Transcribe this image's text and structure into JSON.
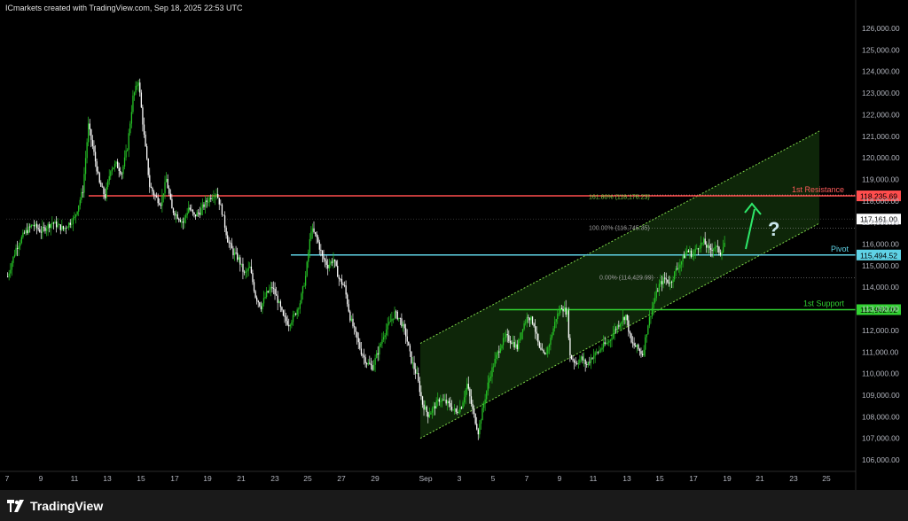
{
  "header": {
    "text": "ICmarkets created with TradingView.com, Sep 18, 2025 22:53 UTC"
  },
  "brand": {
    "name": "TradingView",
    "logo_icon": "tradingview-logo-icon"
  },
  "colors": {
    "background": "#000000",
    "candle_up": "#26c226",
    "candle_down": "#ffffff",
    "resistance": "#ff4d4d",
    "pivot": "#5fd3e6",
    "support": "#32d232",
    "channel": "#7fd84a",
    "channel_fill": "#0f2a0a",
    "arrow": "#2ee86a",
    "question": "#c9e6ec"
  },
  "chart_data": {
    "type": "candlestick",
    "title": "",
    "xlabel": "",
    "ylabel": "",
    "ylim": [
      105500,
      126500
    ],
    "x_tick_labels": [
      "7",
      "9",
      "11",
      "13",
      "15",
      "17",
      "19",
      "21",
      "23",
      "25",
      "27",
      "29",
      "Sep",
      "3",
      "5",
      "7",
      "9",
      "11",
      "13",
      "15",
      "17",
      "19",
      "21",
      "23",
      "25"
    ],
    "y_tick_labels": [
      "106,000.00",
      "107,000.00",
      "108,000.00",
      "109,000.00",
      "110,000.00",
      "111,000.00",
      "112,000.00",
      "113,000.00",
      "114,000.00",
      "115,000.00",
      "116,000.00",
      "117,000.00",
      "118,000.00",
      "119,000.00",
      "120,000.00",
      "121,000.00",
      "122,000.00",
      "123,000.00",
      "124,000.00",
      "125,000.00",
      "126,000.00"
    ],
    "y_ticks": [
      106000,
      107000,
      108000,
      109000,
      110000,
      111000,
      112000,
      113000,
      114000,
      115000,
      116000,
      117000,
      118000,
      119000,
      120000,
      121000,
      122000,
      123000,
      124000,
      125000,
      126000
    ],
    "price_path": [
      [
        0,
        114500
      ],
      [
        3,
        115800
      ],
      [
        6,
        116500
      ],
      [
        9,
        116900
      ],
      [
        12,
        116600
      ],
      [
        16,
        117000
      ],
      [
        20,
        116700
      ],
      [
        24,
        117200
      ],
      [
        27,
        118500
      ],
      [
        29,
        121500
      ],
      [
        31,
        120200
      ],
      [
        33,
        118800
      ],
      [
        35,
        118200
      ],
      [
        37,
        119500
      ],
      [
        39,
        119700
      ],
      [
        41,
        119300
      ],
      [
        43,
        120500
      ],
      [
        45,
        122800
      ],
      [
        47,
        123600
      ],
      [
        49,
        121000
      ],
      [
        51,
        118700
      ],
      [
        53,
        118200
      ],
      [
        55,
        117900
      ],
      [
        57,
        119000
      ],
      [
        59,
        117600
      ],
      [
        61,
        117300
      ],
      [
        63,
        117000
      ],
      [
        65,
        117700
      ],
      [
        67,
        117300
      ],
      [
        69,
        117500
      ],
      [
        71,
        117900
      ],
      [
        73,
        118200
      ],
      [
        75,
        118400
      ],
      [
        77,
        117500
      ],
      [
        79,
        116200
      ],
      [
        81,
        115600
      ],
      [
        83,
        115300
      ],
      [
        85,
        114600
      ],
      [
        87,
        114900
      ],
      [
        89,
        113600
      ],
      [
        91,
        113100
      ],
      [
        93,
        113700
      ],
      [
        95,
        114000
      ],
      [
        97,
        113400
      ],
      [
        99,
        112600
      ],
      [
        101,
        112300
      ],
      [
        103,
        112700
      ],
      [
        105,
        113300
      ],
      [
        107,
        114500
      ],
      [
        109,
        116700
      ],
      [
        111,
        116300
      ],
      [
        113,
        115400
      ],
      [
        115,
        115000
      ],
      [
        117,
        115300
      ],
      [
        119,
        114400
      ],
      [
        121,
        114000
      ],
      [
        123,
        112600
      ],
      [
        125,
        111800
      ],
      [
        127,
        111000
      ],
      [
        129,
        110500
      ],
      [
        131,
        110300
      ],
      [
        133,
        111000
      ],
      [
        135,
        111800
      ],
      [
        137,
        112300
      ],
      [
        139,
        112800
      ],
      [
        141,
        112500
      ],
      [
        143,
        111800
      ],
      [
        145,
        110600
      ],
      [
        147,
        109900
      ],
      [
        149,
        108600
      ],
      [
        151,
        108100
      ],
      [
        153,
        108400
      ],
      [
        155,
        108800
      ],
      [
        157,
        108700
      ],
      [
        159,
        108500
      ],
      [
        161,
        108200
      ],
      [
        163,
        108500
      ],
      [
        165,
        109500
      ],
      [
        167,
        108300
      ],
      [
        169,
        107300
      ],
      [
        171,
        108600
      ],
      [
        173,
        109800
      ],
      [
        175,
        110600
      ],
      [
        177,
        111300
      ],
      [
        179,
        111700
      ],
      [
        181,
        111500
      ],
      [
        183,
        111200
      ],
      [
        185,
        112200
      ],
      [
        187,
        112700
      ],
      [
        189,
        112300
      ],
      [
        191,
        111100
      ],
      [
        193,
        110800
      ],
      [
        195,
        111600
      ],
      [
        197,
        112600
      ],
      [
        199,
        113100
      ],
      [
        201,
        112800
      ],
      [
        202,
        110800
      ],
      [
        204,
        110500
      ],
      [
        206,
        110700
      ],
      [
        208,
        110400
      ],
      [
        210,
        110800
      ],
      [
        212,
        111000
      ],
      [
        214,
        111300
      ],
      [
        216,
        111500
      ],
      [
        218,
        112000
      ],
      [
        220,
        112400
      ],
      [
        222,
        112700
      ],
      [
        224,
        111400
      ],
      [
        226,
        111200
      ],
      [
        228,
        110900
      ],
      [
        230,
        112300
      ],
      [
        232,
        113300
      ],
      [
        234,
        114100
      ],
      [
        236,
        114400
      ],
      [
        238,
        114200
      ],
      [
        240,
        114800
      ],
      [
        242,
        115200
      ],
      [
        244,
        115700
      ],
      [
        246,
        115500
      ],
      [
        248,
        115900
      ],
      [
        250,
        116100
      ],
      [
        252,
        115700
      ],
      [
        254,
        115900
      ],
      [
        256,
        115600
      ],
      [
        258,
        116200
      ],
      [
        260,
        115600
      ],
      [
        262,
        115300
      ],
      [
        264,
        115000
      ],
      [
        266,
        114800
      ],
      [
        268,
        115100
      ],
      [
        270,
        115300
      ],
      [
        272,
        115800
      ],
      [
        274,
        116400
      ],
      [
        276,
        117100
      ],
      [
        278,
        116800
      ],
      [
        280,
        116100
      ],
      [
        282,
        116600
      ],
      [
        284,
        117200
      ],
      [
        286,
        117400
      ],
      [
        288,
        117700
      ],
      [
        290,
        117300
      ],
      [
        291,
        117161
      ]
    ],
    "levels": [
      {
        "name": "1st Resistance",
        "value": 118235.69,
        "label": "118,235.69"
      },
      {
        "name": "Pivot",
        "value": 115494.52,
        "label": "115,494.52"
      },
      {
        "name": "1st Support",
        "value": 112962.02,
        "label": "112,962.02"
      }
    ],
    "current_price": {
      "value": 117161.0,
      "label": "117,161.00"
    },
    "fib_labels": [
      {
        "text": "161.80% (118,176.23)",
        "value": 118176.23
      },
      {
        "text": "100.00% (116,745.35)",
        "value": 116745.35
      },
      {
        "text": "0.00% (114,429.99)",
        "value": 114429.99
      }
    ],
    "channel": {
      "upper": [
        [
          0,
          111400
        ],
        [
          13.2,
          121200
        ]
      ],
      "lower": [
        [
          0,
          107000
        ],
        [
          13.2,
          116900
        ]
      ]
    },
    "annotation": "?"
  }
}
